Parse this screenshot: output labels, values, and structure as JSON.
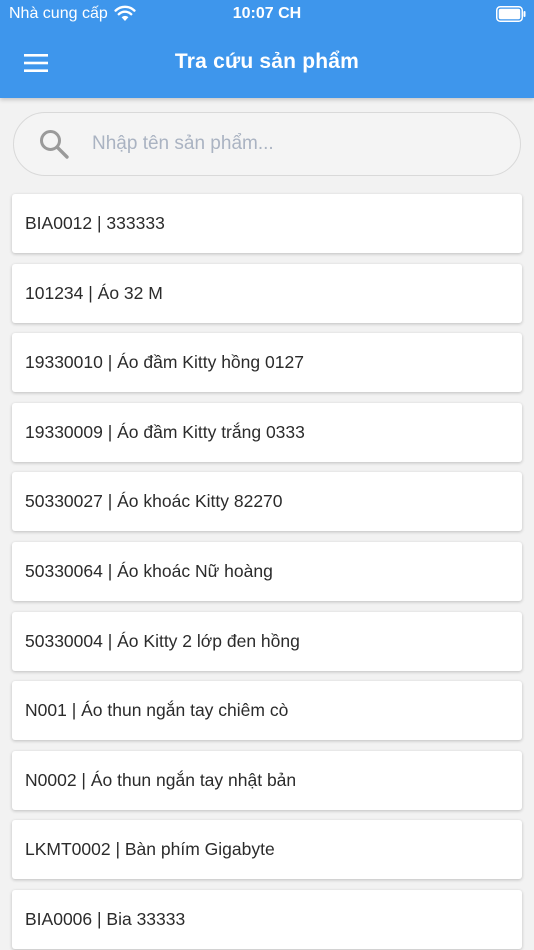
{
  "status_bar": {
    "carrier": "Nhà cung cấp",
    "time": "10:07 CH",
    "wifi_icon": "wifi-icon",
    "battery_icon": "battery-icon"
  },
  "app_bar": {
    "title": "Tra cứu sản phẩm",
    "menu_icon": "hamburger-menu-icon",
    "color": "#3e96ec"
  },
  "search": {
    "placeholder": "Nhập tên sản phẩm...",
    "value": "",
    "icon": "search-icon"
  },
  "products": [
    {
      "label": "BIA0012 | 333333"
    },
    {
      "label": "101234 | Áo 32 M"
    },
    {
      "label": "19330010 | Áo đầm Kitty hồng 0127"
    },
    {
      "label": "19330009 | Áo đầm Kitty trắng 0333"
    },
    {
      "label": "50330027 | Áo khoác Kitty 82270"
    },
    {
      "label": "50330064 | Áo khoác Nữ hoàng"
    },
    {
      "label": "50330004 | Áo Kitty 2 lớp đen hồng"
    },
    {
      "label": "N001 | Áo thun ngắn tay chiêm cò"
    },
    {
      "label": "N0002 | Áo thun ngắn tay nhật bản"
    },
    {
      "label": "LKMT0002 | Bàn phím Gigabyte"
    },
    {
      "label": "BIA0006 | Bia 33333"
    }
  ]
}
